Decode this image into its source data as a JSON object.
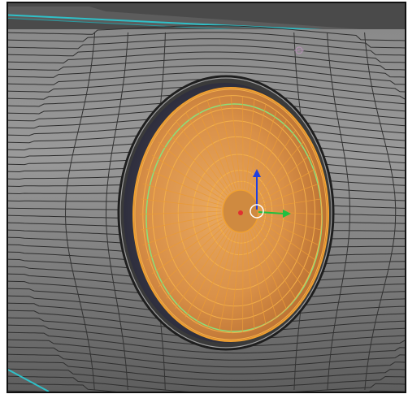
{
  "viewport": {
    "mode": "edit-mode-3d-viewport",
    "colors": {
      "background": "#545454",
      "mesh_surface": "#7a7a7a",
      "wireframe": "#2c2c2c",
      "selection": "#f0a030",
      "selection_fill": "#d9904a",
      "seam_edge": "#2fc0c8",
      "highlight_ring": "#8be07a",
      "frame": "#111111"
    },
    "gizmo": {
      "x_axis_color": "#e03030",
      "y_axis_color": "#20c040",
      "z_axis_color": "#2040e0",
      "cursor_icon": "3d-cursor-icon"
    }
  }
}
